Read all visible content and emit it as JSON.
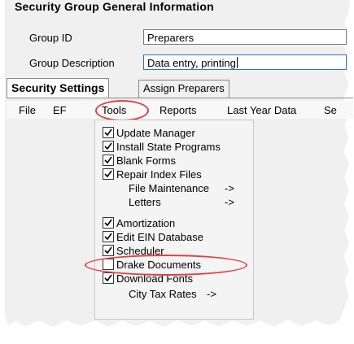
{
  "section_title": "Security Group General Information",
  "group_id": {
    "label": "Group ID",
    "value": "Preparers"
  },
  "group_description": {
    "label": "Group Description",
    "value": "Data entry, printing"
  },
  "tabs": [
    {
      "label": "Security Settings",
      "active": true
    },
    {
      "label": "Assign Preparers",
      "active": false
    }
  ],
  "menubar": [
    "File",
    "EF",
    "Tools",
    "Reports",
    "Last Year Data",
    "Se"
  ],
  "tools_menu": [
    {
      "label": "Update Manager",
      "checked": true
    },
    {
      "label": "Install State Programs",
      "checked": true
    },
    {
      "label": "Blank Forms",
      "checked": true
    },
    {
      "label": "Repair Index Files",
      "checked": true
    },
    {
      "label": "File Maintenance",
      "arrow": "->"
    },
    {
      "label": "Letters",
      "arrow": "->"
    },
    {
      "label": "Amortization",
      "checked": true
    },
    {
      "label": "Edit EIN Database",
      "checked": true
    },
    {
      "label": "Scheduler",
      "checked": true
    },
    {
      "label": "Drake Documents",
      "checked": false
    },
    {
      "label": "Download Fonts",
      "checked": true
    },
    {
      "label": "City Tax Rates",
      "arrow": "->"
    }
  ],
  "colors": {
    "highlight_oval": "#e0414a",
    "field_focus": "#2a6fd1"
  }
}
